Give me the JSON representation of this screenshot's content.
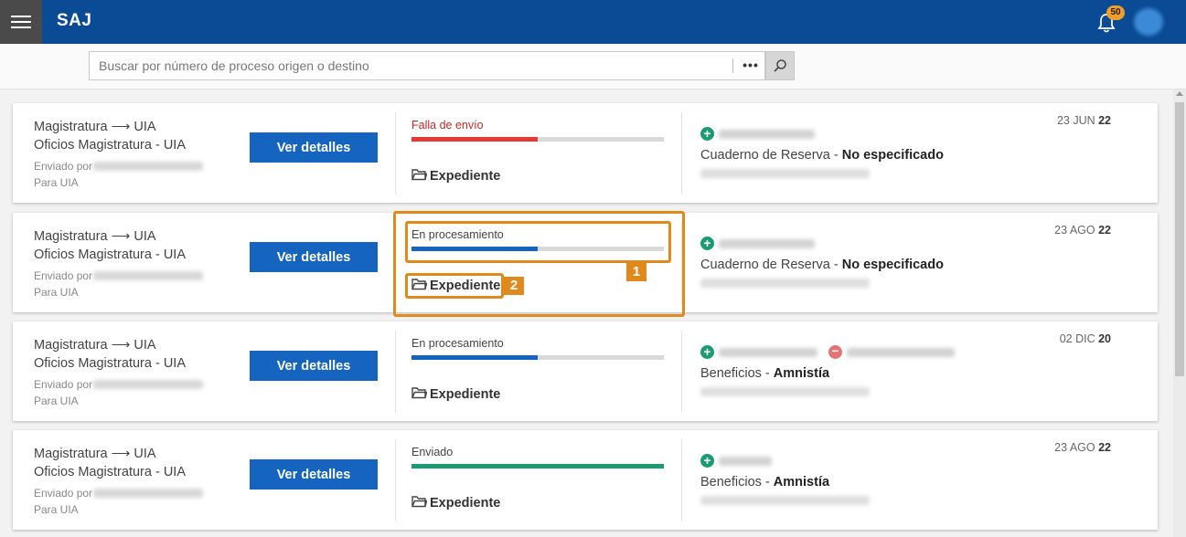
{
  "app": {
    "title": "SAJ"
  },
  "header": {
    "menu_icon": "hamburger-menu-icon",
    "notifications_count": "50",
    "bell_icon": "bell-icon",
    "avatar_icon": "user-avatar"
  },
  "search": {
    "placeholder": "Buscar por número de proceso origen o destino",
    "value": "",
    "more_label": "•••",
    "search_icon": "search-icon"
  },
  "records": [
    {
      "route": "Magistratura ⟶ UIA",
      "type": "Oficios Magistratura - UIA",
      "sent_by_label": "Enviado por",
      "para": "Para UIA",
      "details_button": "Ver detalles",
      "status": "Falla de envío",
      "status_kind": "error",
      "progress": 0.5,
      "progress_color": "#e53935",
      "expediente": "Expediente",
      "cuaderno_prefix": "Cuaderno de Reserva - ",
      "cuaderno_value": "No especificado",
      "date_prefix": "23 JUN ",
      "date_year": "22"
    },
    {
      "route": "Magistratura ⟶ UIA",
      "type": "Oficios Magistratura - UIA",
      "sent_by_label": "Enviado por",
      "para": "Para UIA",
      "details_button": "Ver detalles",
      "status": "En procesamiento",
      "status_kind": "processing",
      "progress": 0.5,
      "progress_color": "#1565c0",
      "expediente": "Expediente",
      "cuaderno_prefix": "Cuaderno de Reserva - ",
      "cuaderno_value": "No especificado",
      "date_prefix": "23 AGO ",
      "date_year": "22"
    },
    {
      "route": "Magistratura ⟶ UIA",
      "type": "Oficios Magistratura - UIA",
      "sent_by_label": "Enviado por",
      "para": "Para UIA",
      "details_button": "Ver detalles",
      "status": "En procesamiento",
      "status_kind": "processing",
      "progress": 0.5,
      "progress_color": "#1565c0",
      "expediente": "Expediente",
      "cuaderno_prefix": "Beneficios - ",
      "cuaderno_value": "Amnistía",
      "date_prefix": "02 DIC ",
      "date_year": "20"
    },
    {
      "route": "Magistratura ⟶ UIA",
      "type": "Oficios Magistratura - UIA",
      "sent_by_label": "Enviado por",
      "para": "Para UIA",
      "details_button": "Ver detalles",
      "status": "Enviado",
      "status_kind": "sent",
      "progress": 1.0,
      "progress_color": "#1a9c6f",
      "expediente": "Expediente",
      "cuaderno_prefix": "Beneficios - ",
      "cuaderno_value": "Amnistía",
      "date_prefix": "23 AGO ",
      "date_year": "22"
    }
  ],
  "annotations": {
    "label_1": "1",
    "label_2": "2"
  },
  "colors": {
    "header": "#0b4a94",
    "button": "#1565c0",
    "annotation": "#e08a1e"
  }
}
